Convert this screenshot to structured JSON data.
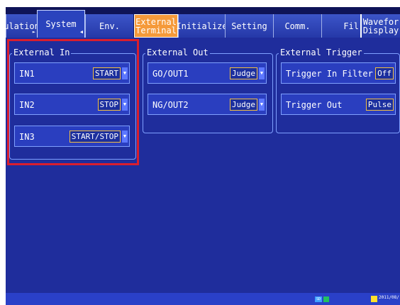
{
  "tabs": [
    {
      "label": "ulation",
      "active": false
    },
    {
      "label": "System",
      "active": true
    },
    {
      "label": "Env.",
      "active": false
    },
    {
      "label_line1": "External",
      "label_line2": "Terminal",
      "highlight": true
    },
    {
      "label": "Initialize",
      "active": false
    },
    {
      "label": "Setting",
      "active": false
    },
    {
      "label": "Comm.",
      "active": false
    },
    {
      "label": "Fil",
      "active": false
    },
    {
      "label_line1": "Wavefor",
      "label_line2": "Display",
      "active": false
    }
  ],
  "external_in": {
    "title": "External In",
    "rows": [
      {
        "label": "IN1",
        "value": "START"
      },
      {
        "label": "IN2",
        "value": "STOP"
      },
      {
        "label": "IN3",
        "value": "START/STOP"
      }
    ]
  },
  "external_out": {
    "title": "External Out",
    "rows": [
      {
        "label": "GO/OUT1",
        "value": "Judge"
      },
      {
        "label": "NG/OUT2",
        "value": "Judge"
      }
    ]
  },
  "external_trigger": {
    "title": "External Trigger",
    "rows": [
      {
        "label": "Trigger In Filter",
        "value": "Off"
      },
      {
        "label": "Trigger Out",
        "value": "Pulse"
      }
    ]
  },
  "statusbar": {
    "sd": "SD",
    "date": "2011/08/"
  },
  "colors": {
    "background": "#1f2d9c",
    "highlight_tab": "#f59a3a",
    "value_border": "#f4c040",
    "annotation": "#d91e2e"
  }
}
